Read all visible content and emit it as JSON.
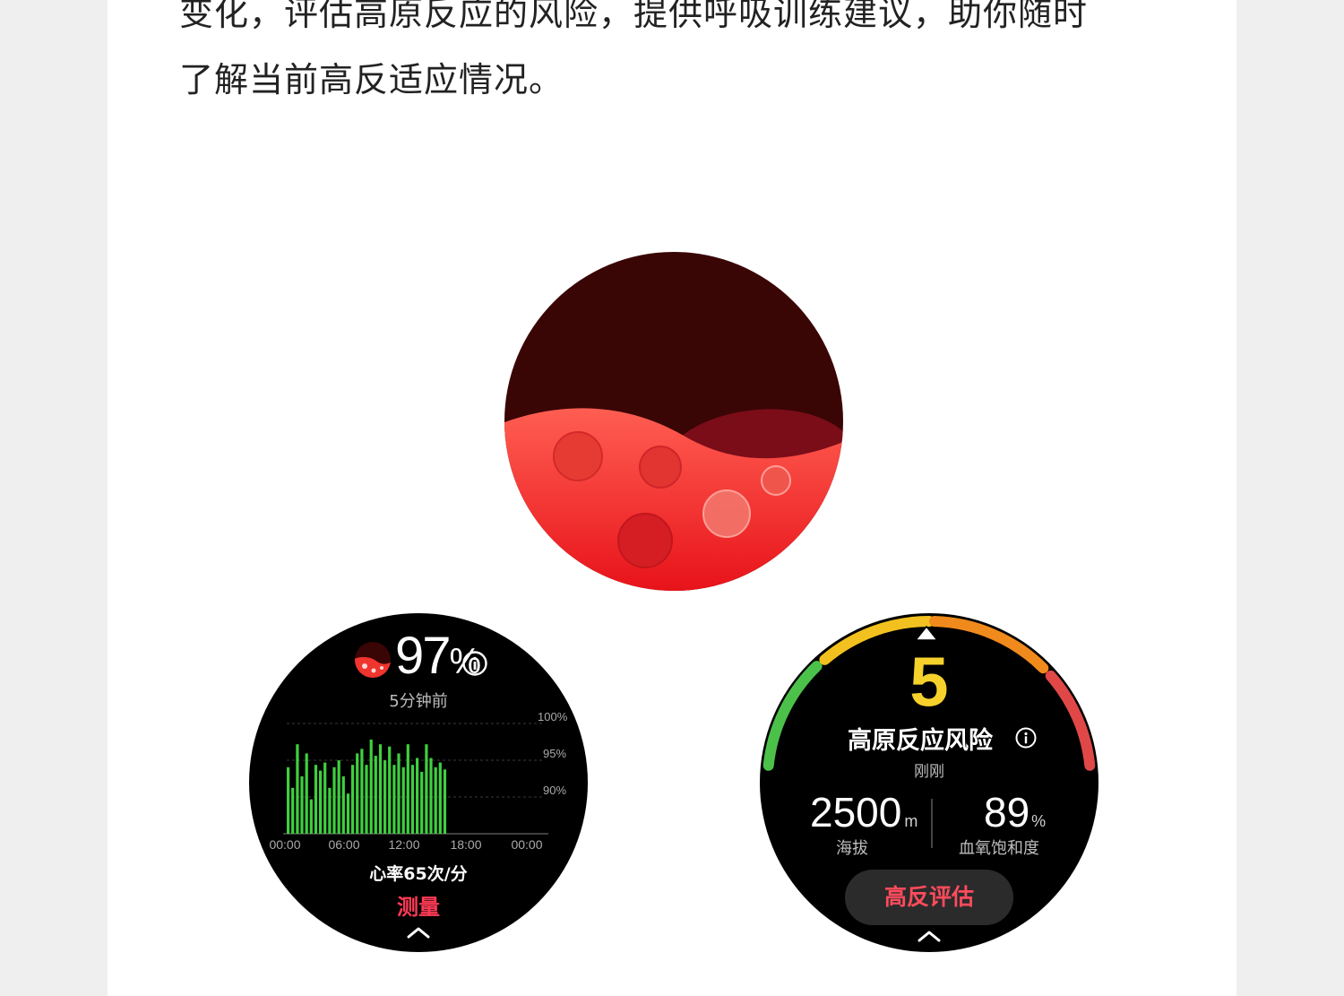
{
  "description": {
    "line1": "变化，评估高原反应的风险，提供呼吸训练建议，助你随时",
    "line2": "了解当前高反适应情况。"
  },
  "app_icon": {
    "icon": "blood-oxygen-app-icon",
    "colors": {
      "top": "#3a0505",
      "wave_dark": "#7a0d18",
      "liquid_top": "#ff5a4e",
      "liquid_bottom": "#e8131a"
    }
  },
  "spo2_watch": {
    "icon": "blood-oxygen-icon",
    "value": "97",
    "unit": "%",
    "info_icon": "info-icon",
    "time_ago": "5分钟前",
    "y_labels": [
      "100%",
      "95%",
      "90%"
    ],
    "x_labels": [
      "00:00",
      "06:00",
      "12:00",
      "18:00",
      "00:00"
    ],
    "heart_rate": "心率65次/分",
    "measure_label": "测量",
    "up_icon": "chevron-up-icon",
    "bar_color": "#3fcf3f",
    "bar_levels": [
      0.58,
      0.4,
      0.78,
      0.5,
      0.7,
      0.3,
      0.6,
      0.55,
      0.62,
      0.4,
      0.58,
      0.64,
      0.5,
      0.35,
      0.6,
      0.7,
      0.74,
      0.6,
      0.82,
      0.68,
      0.78,
      0.64,
      0.76,
      0.6,
      0.7,
      0.58,
      0.78,
      0.6,
      0.66,
      0.54,
      0.78,
      0.66,
      0.58,
      0.62,
      0.56
    ]
  },
  "risk_watch": {
    "risk_value": "5",
    "risk_label": "高原反应风险",
    "info_icon": "info-icon",
    "updated": "刚刚",
    "altitude_value": "2500",
    "altitude_unit": "m",
    "altitude_label": "海拔",
    "spo2_value": "89",
    "spo2_unit": "%",
    "spo2_label": "血氧饱和度",
    "button_label": "高反评估",
    "up_icon": "chevron-up-icon",
    "marker_icon": "triangle-marker-icon",
    "arc_colors": {
      "green": "#4cc14a",
      "yellow": "#f2c11f",
      "orange": "#f08a1c",
      "red": "#e04848"
    },
    "value_color": "#f6d12b",
    "button_text_color": "#ff4b5c"
  }
}
